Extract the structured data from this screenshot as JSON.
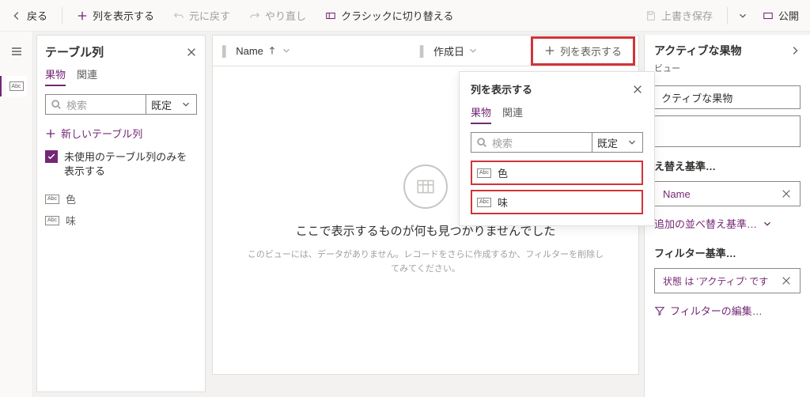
{
  "topbar": {
    "back": "戻る",
    "add_col": "列を表示する",
    "undo": "元に戻す",
    "redo": "やり直し",
    "switch_classic": "クラシックに切り替える",
    "save": "上書き保存",
    "publish": "公開"
  },
  "col_panel": {
    "title": "テーブル列",
    "tab_entity": "果物",
    "tab_related": "関連",
    "search_placeholder": "検索",
    "sort_default": "既定",
    "new_col": "新しいテーブル列",
    "only_unused": "未使用のテーブル列のみを表示する",
    "items": [
      {
        "label": "色"
      },
      {
        "label": "味"
      }
    ]
  },
  "grid": {
    "col_name": "Name",
    "col_created": "作成日",
    "add_col_btn": "列を表示する",
    "empty_title": "ここで表示するものが何も見つかりませんでした",
    "empty_sub": "このビューには、データがありません。レコードをさらに作成するか、フィルターを削除してみてください。"
  },
  "flyout": {
    "title": "列を表示する",
    "tab_entity": "果物",
    "tab_related": "関連",
    "search_placeholder": "検索",
    "sort_default": "既定",
    "items": [
      {
        "label": "色"
      },
      {
        "label": "味"
      }
    ]
  },
  "right": {
    "title": "アクティブな果物",
    "sub": "ビュー",
    "name_partial": "クティブな果物",
    "sort_section": "え替え基準…",
    "sort_chip": "Name",
    "more_sort": "追加の並べ替え基準…",
    "filter_section": "フィルター基準…",
    "filter_chip": "状態 は 'アクティブ' です",
    "filter_edit": "フィルターの編集…"
  }
}
